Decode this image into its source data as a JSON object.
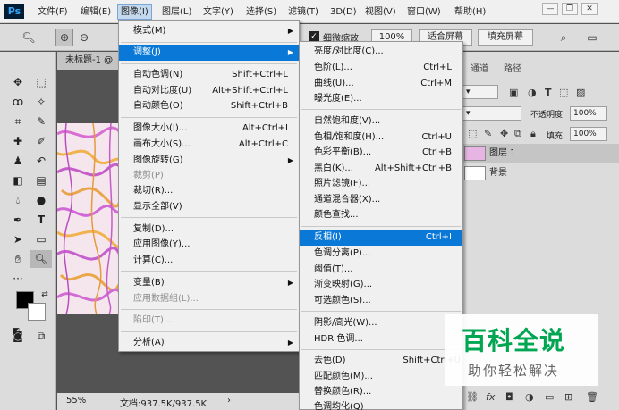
{
  "app": {
    "logo": "Ps"
  },
  "menubar": [
    {
      "label": "文件(F)"
    },
    {
      "label": "编辑(E)"
    },
    {
      "label": "图像(I)"
    },
    {
      "label": "图层(L)"
    },
    {
      "label": "文字(Y)"
    },
    {
      "label": "选择(S)"
    },
    {
      "label": "滤镜(T)"
    },
    {
      "label": "3D(D)"
    },
    {
      "label": "视图(V)"
    },
    {
      "label": "窗口(W)"
    },
    {
      "label": "帮助(H)"
    }
  ],
  "window_controls": {
    "minimize": "—",
    "restore": "❐",
    "close": "✕"
  },
  "options": {
    "tool_icon": "zoom-icon",
    "fine_zoom_label": "细微缩放",
    "fine_zoom_checked": true,
    "zoom_percent": "100%",
    "fit_screen": "适合屏幕",
    "fill_screen": "填充屏幕"
  },
  "document": {
    "tab_title": "未标题-1 @",
    "zoom": "55%",
    "doc_info": "文档:937.5K/937.5K"
  },
  "panel": {
    "tabs": [
      {
        "label": "通道"
      },
      {
        "label": "路径"
      }
    ],
    "opacity_label": "不透明度:",
    "opacity_value": "100%",
    "fill_label": "填充:",
    "fill_value": "100%",
    "layers": [
      {
        "name": "图层 1"
      },
      {
        "name": "背景"
      }
    ],
    "fx_label": "fx"
  },
  "image_menu": {
    "items": [
      {
        "label": "模式(M)",
        "shortcut": "",
        "submenu": true
      },
      {
        "label": "调整(J)",
        "shortcut": "",
        "submenu": true,
        "highlighted": true
      },
      {
        "label": "自动色调(N)",
        "shortcut": "Shift+Ctrl+L"
      },
      {
        "label": "自动对比度(U)",
        "shortcut": "Alt+Shift+Ctrl+L"
      },
      {
        "label": "自动颜色(O)",
        "shortcut": "Shift+Ctrl+B"
      },
      {
        "label": "图像大小(I)...",
        "shortcut": "Alt+Ctrl+I"
      },
      {
        "label": "画布大小(S)...",
        "shortcut": "Alt+Ctrl+C"
      },
      {
        "label": "图像旋转(G)",
        "shortcut": "",
        "submenu": true
      },
      {
        "label": "裁剪(P)",
        "shortcut": "",
        "disabled": true
      },
      {
        "label": "裁切(R)...",
        "shortcut": ""
      },
      {
        "label": "显示全部(V)",
        "shortcut": ""
      },
      {
        "label": "复制(D)...",
        "shortcut": ""
      },
      {
        "label": "应用图像(Y)...",
        "shortcut": ""
      },
      {
        "label": "计算(C)...",
        "shortcut": ""
      },
      {
        "label": "变量(B)",
        "shortcut": "",
        "submenu": true
      },
      {
        "label": "应用数据组(L)...",
        "shortcut": "",
        "disabled": true
      },
      {
        "label": "陷印(T)...",
        "shortcut": "",
        "disabled": true
      },
      {
        "label": "分析(A)",
        "shortcut": "",
        "submenu": true
      }
    ]
  },
  "adjust_menu": {
    "items": [
      {
        "label": "亮度/对比度(C)...",
        "shortcut": ""
      },
      {
        "label": "色阶(L)...",
        "shortcut": "Ctrl+L"
      },
      {
        "label": "曲线(U)...",
        "shortcut": "Ctrl+M"
      },
      {
        "label": "曝光度(E)...",
        "shortcut": ""
      },
      {
        "label": "自然饱和度(V)...",
        "shortcut": ""
      },
      {
        "label": "色相/饱和度(H)...",
        "shortcut": "Ctrl+U"
      },
      {
        "label": "色彩平衡(B)...",
        "shortcut": "Ctrl+B"
      },
      {
        "label": "黑白(K)...",
        "shortcut": "Alt+Shift+Ctrl+B"
      },
      {
        "label": "照片滤镜(F)...",
        "shortcut": ""
      },
      {
        "label": "通道混合器(X)...",
        "shortcut": ""
      },
      {
        "label": "颜色查找...",
        "shortcut": ""
      },
      {
        "label": "反相(I)",
        "shortcut": "Ctrl+I",
        "highlighted": true
      },
      {
        "label": "色调分离(P)...",
        "shortcut": ""
      },
      {
        "label": "阈值(T)...",
        "shortcut": ""
      },
      {
        "label": "渐变映射(G)...",
        "shortcut": ""
      },
      {
        "label": "可选颜色(S)...",
        "shortcut": ""
      },
      {
        "label": "阴影/高光(W)...",
        "shortcut": ""
      },
      {
        "label": "HDR 色调...",
        "shortcut": ""
      },
      {
        "label": "去色(D)",
        "shortcut": "Shift+Ctrl+U"
      },
      {
        "label": "匹配颜色(M)...",
        "shortcut": ""
      },
      {
        "label": "替换颜色(R)...",
        "shortcut": ""
      },
      {
        "label": "色调均化(Q)",
        "shortcut": ""
      }
    ]
  },
  "watermark": {
    "title": "百科全说",
    "subtitle": "助你轻松解决"
  },
  "colors": {
    "menu_highlight": "#0a78d7",
    "watermark_green": "#00a651"
  }
}
